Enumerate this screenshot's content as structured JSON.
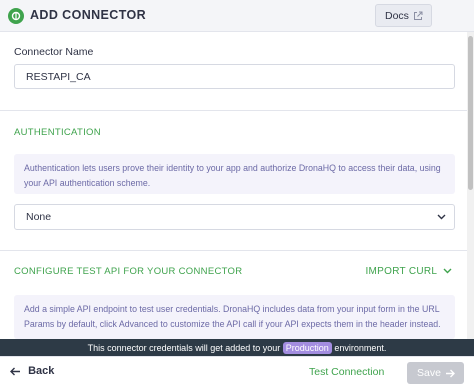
{
  "header": {
    "title": "ADD CONNECTOR",
    "docs_label": "Docs"
  },
  "connector_name": {
    "label": "Connector Name",
    "value": "RESTAPI_CA"
  },
  "authentication": {
    "heading": "AUTHENTICATION",
    "info": "Authentication lets users prove their identity to your app and authorize DronaHQ to access their data, using your API authentication scheme.",
    "selected": "None"
  },
  "test_api": {
    "heading": "CONFIGURE TEST API FOR YOUR CONNECTOR",
    "import_label": "IMPORT CURL",
    "info": "Add a simple API endpoint to test user credentials. DronaHQ includes data from your input form in the URL Params by default, click Advanced to customize the API call if your API expects them in the header instead."
  },
  "banner": {
    "text_before": "This connector credentials will get added to your",
    "environment": "Production",
    "text_after": "environment."
  },
  "footer": {
    "back_label": "Back",
    "test_label": "Test Connection",
    "save_label": "Save"
  },
  "colors": {
    "accent_green": "#3fa34d",
    "banner_bg": "#2d3a46",
    "environment_pill": "#a38de0",
    "info_box_bg": "#f4f3fb"
  },
  "icons": {
    "logo": "dronahq-logo-icon",
    "docs": "external-link-icon",
    "select": "chevron-down-icon",
    "import": "chevron-down-icon",
    "back": "arrow-left-icon",
    "save": "arrow-right-icon"
  }
}
